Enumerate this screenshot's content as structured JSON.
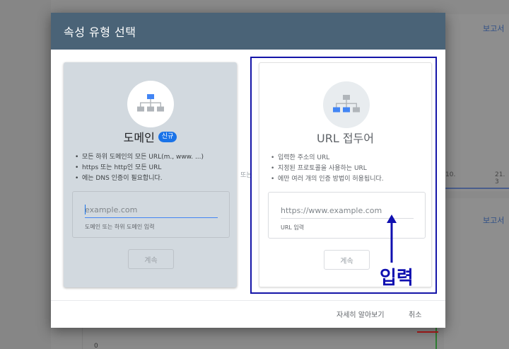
{
  "background": {
    "top_link": "보고서",
    "bottom_link": "보고서",
    "tick_1": "10.",
    "tick_2": "21. 3",
    "zero_tick": "0"
  },
  "dialog": {
    "title": "속성 유형 선택",
    "or_label": "또는",
    "domain_card": {
      "icon": "sitemap-icon",
      "title": "도메인",
      "badge": "신규",
      "bullets": [
        "모든 하위 도메인의 모든 URL(m., www. ...)",
        "https 또는 http인 모든 URL",
        "에는 DNS 인증이 필요합니다."
      ],
      "input_placeholder": "example.com",
      "input_helper": "도메인 또는 하위 도메인 입력",
      "continue_label": "계속"
    },
    "url_card": {
      "icon": "sitemap-icon",
      "title": "URL 접두어",
      "bullets": [
        "입력한 주소의 URL",
        "지정된 프로토콜을 사용하는 URL",
        "에만 여러 개의 인증 방법이 허용됩니다."
      ],
      "input_placeholder": "https://www.example.com",
      "input_helper": "URL 입력",
      "continue_label": "계속"
    },
    "footer": {
      "learn_more": "자세히 알아보기",
      "cancel": "취소"
    }
  },
  "annotation": {
    "label": "입력",
    "color": "#1010b0"
  },
  "colors": {
    "header": "#4a6377",
    "accent": "#1a73e8"
  }
}
